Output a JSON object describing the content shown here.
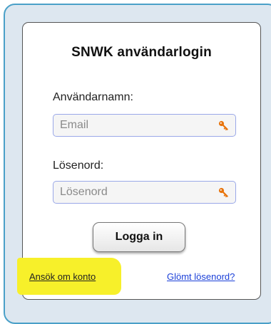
{
  "login": {
    "title": "SNWK användarlogin",
    "username_label": "Användarnamn:",
    "username_placeholder": "Email",
    "password_label": "Lösenord:",
    "password_placeholder": "Lösenord",
    "submit_label": "Logga in",
    "apply_link": "Ansök om konto",
    "forgot_link": "Glömt lösenord?"
  },
  "colors": {
    "frame_border": "#4aa0c8",
    "input_border": "#9aa8e8",
    "key_icon": "#e8740c",
    "highlight": "#f7f02a",
    "forgot_link": "#1a3fd8"
  },
  "icons": {
    "field_icon": "key-icon"
  }
}
